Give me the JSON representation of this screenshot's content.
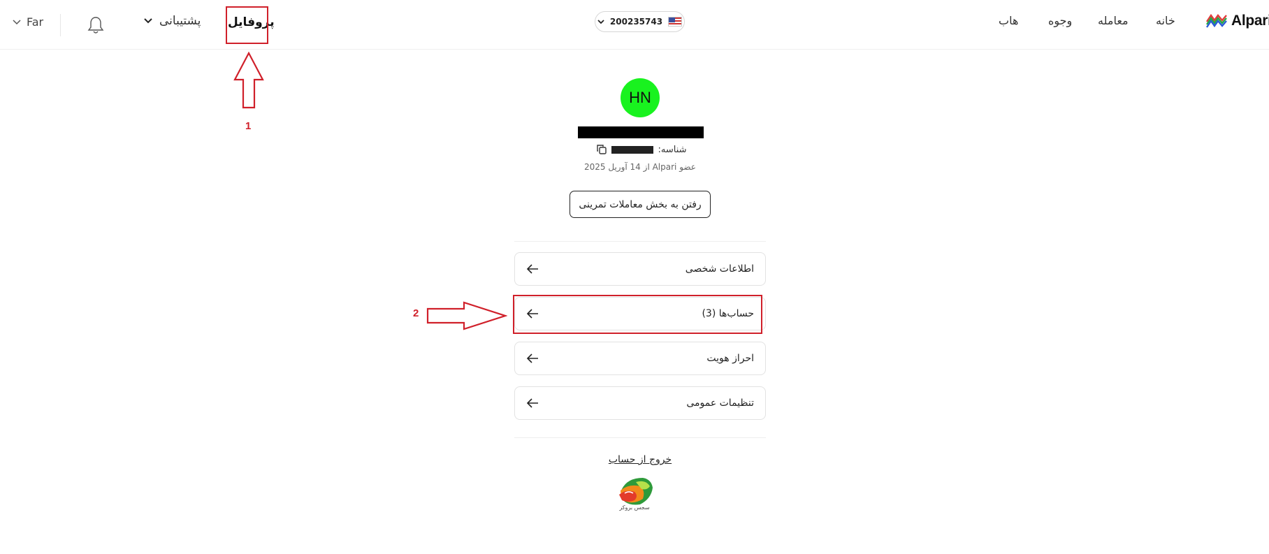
{
  "topbar": {
    "language": "Far",
    "support_label": "پشتیبانی",
    "profile_label": "پروفایل",
    "account_number": "200235743",
    "nav_links": [
      "خانه",
      "معامله",
      "وجوه",
      "هاب"
    ],
    "brand": "Alpari"
  },
  "profile": {
    "initials": "HN",
    "id_label": "شناسه:",
    "member_since": "عضو Alpari از 14 آوریل 2025",
    "demo_button": "رفتن به بخش معاملات تمرینی"
  },
  "menu": [
    {
      "label": "اطلاعات شخصی"
    },
    {
      "label": "حساب‌ها (3)"
    },
    {
      "label": "احراز هویت"
    },
    {
      "label": "تنظیمات عمومی"
    }
  ],
  "logout_label": "خروج از حساب",
  "watermark_caption": "سجس بروکر",
  "annotations": {
    "step1": "1",
    "step2": "2"
  },
  "colors": {
    "avatar": "#19f21f",
    "annotation": "#d0202a"
  },
  "icons": {
    "bell": "bell-icon",
    "copy": "copy-icon",
    "arrow": "arrow-left-icon",
    "flag": "us-flag-icon"
  }
}
